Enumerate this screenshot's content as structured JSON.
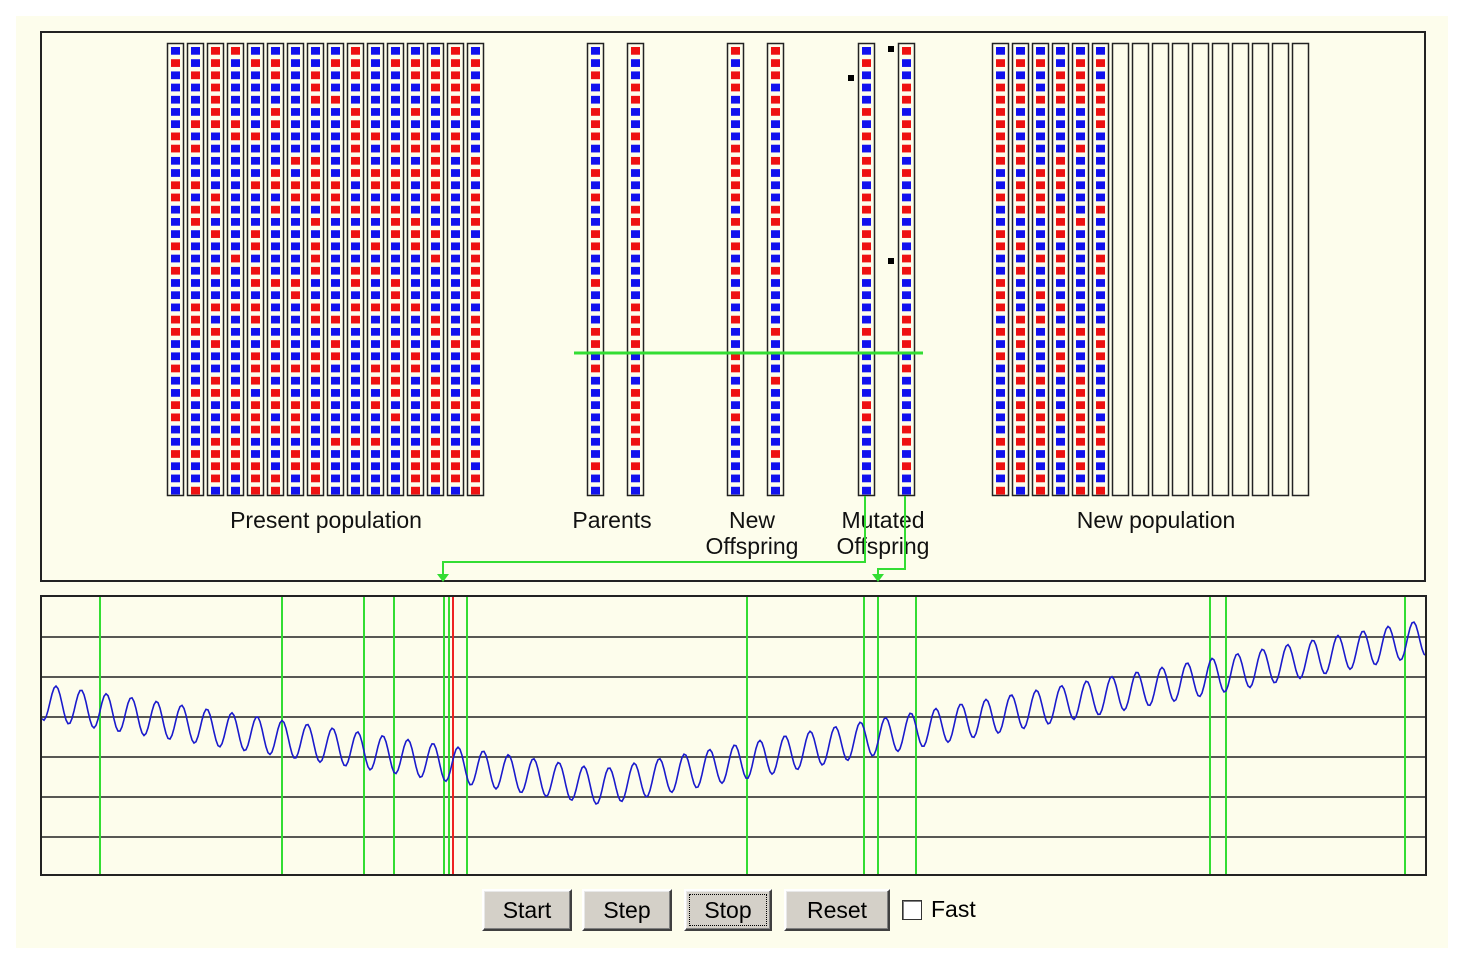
{
  "labels": {
    "present": "Present population",
    "parents": "Parents",
    "new_offspring_1": "New",
    "new_offspring_2": "Offspring",
    "mutated_1": "Mutated",
    "mutated_2": "Offspring",
    "new_population": "New population"
  },
  "buttons": {
    "start": "Start",
    "step": "Step",
    "stop": "Stop",
    "reset": "Reset"
  },
  "fast": {
    "label": "Fast",
    "checked": false
  },
  "colors": {
    "gene_red": "#ee1111",
    "gene_blue": "#1111ee",
    "green": "#33dd33",
    "red_marker": "#ee2222",
    "curve": "#1a1acc",
    "background": "#fdfdec"
  },
  "population": {
    "genes_per_chromosome": 37,
    "present_count": 16,
    "new_population_filled": 6,
    "new_population_total": 16
  }
}
